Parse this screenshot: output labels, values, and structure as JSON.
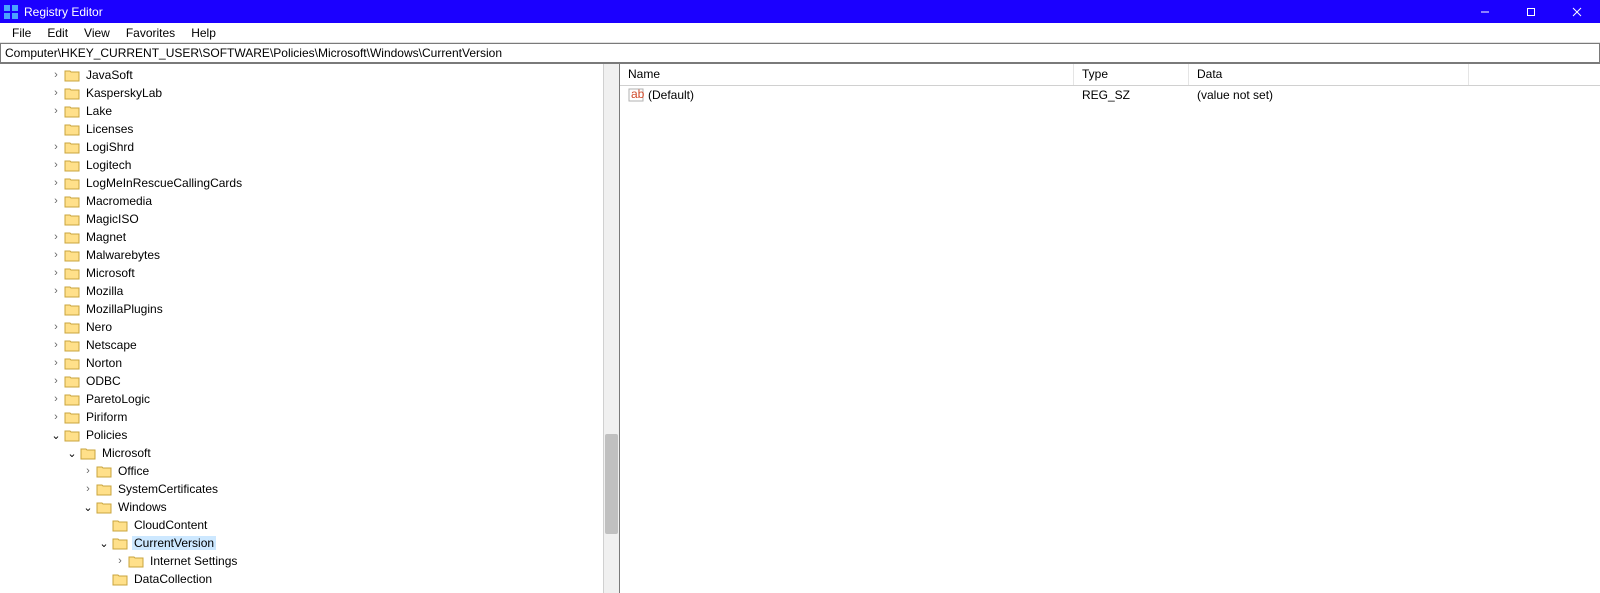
{
  "window": {
    "title": "Registry Editor"
  },
  "menus": {
    "file": "File",
    "edit": "Edit",
    "view": "View",
    "favorites": "Favorites",
    "help": "Help"
  },
  "address": "Computer\\HKEY_CURRENT_USER\\SOFTWARE\\Policies\\Microsoft\\Windows\\CurrentVersion",
  "tree": {
    "t0": "JavaSoft",
    "t1": "KasperskyLab",
    "t2": "Lake",
    "t3": "Licenses",
    "t4": "LogiShrd",
    "t5": "Logitech",
    "t6": "LogMeInRescueCallingCards",
    "t7": "Macromedia",
    "t8": "MagicISO",
    "t9": "Magnet",
    "t10": "Malwarebytes",
    "t11": "Microsoft",
    "t12": "Mozilla",
    "t13": "MozillaPlugins",
    "t14": "Nero",
    "t15": "Netscape",
    "t16": "Norton",
    "t17": "ODBC",
    "t18": "ParetoLogic",
    "t19": "Piriform",
    "t20": "Policies",
    "t21": "Microsoft",
    "t22": "Office",
    "t23": "SystemCertificates",
    "t24": "Windows",
    "t25": "CloudContent",
    "t26": "CurrentVersion",
    "t27": "Internet Settings",
    "t28": "DataCollection"
  },
  "list": {
    "headers": {
      "name": "Name",
      "type": "Type",
      "data": "Data"
    },
    "row0": {
      "name": "(Default)",
      "type": "REG_SZ",
      "data": "(value not set)"
    }
  }
}
